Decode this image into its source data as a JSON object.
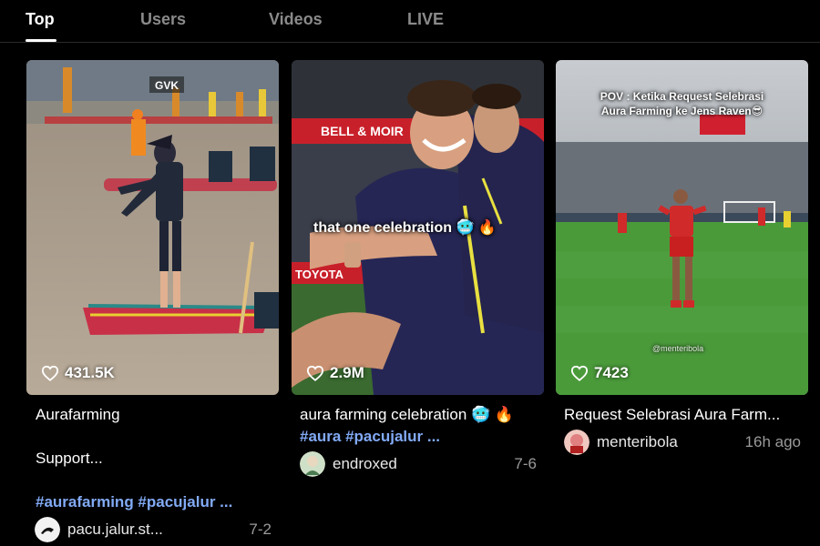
{
  "tabs": [
    {
      "label": "Top",
      "active": true
    },
    {
      "label": "Users",
      "active": false
    },
    {
      "label": "Videos",
      "active": false
    },
    {
      "label": "LIVE",
      "active": false
    }
  ],
  "videos": [
    {
      "likes": "431.5K",
      "title": "Aurafarming",
      "subtitle": "Support...",
      "tags": "#aurafarming #pacujalur ...",
      "username": "pacu.jalur.st...",
      "date": "7-2",
      "logo_text": "GVK"
    },
    {
      "likes": "2.9M",
      "overlay": "that one celebration 🥶 🔥",
      "title": "aura farming celebration 🥶 🔥",
      "tags": "#aura #pacujalur ...",
      "username": "endroxed",
      "date": "7-6",
      "banner_text": "BELL & MOIR",
      "banner_text2": "TOYOTA"
    },
    {
      "likes": "7423",
      "overlay_line1": "POV : Ketika Request Selebrasi",
      "overlay_line2": "Aura Farming ke Jens Raven😎",
      "watermark": "@menteribola",
      "title": "Request Selebrasi Aura Farm...",
      "username": "menteribola",
      "date": "16h ago"
    }
  ],
  "colors": {
    "background": "#000000",
    "tag_blue": "#82aaf5",
    "tab_inactive": "#8a8a8a"
  }
}
